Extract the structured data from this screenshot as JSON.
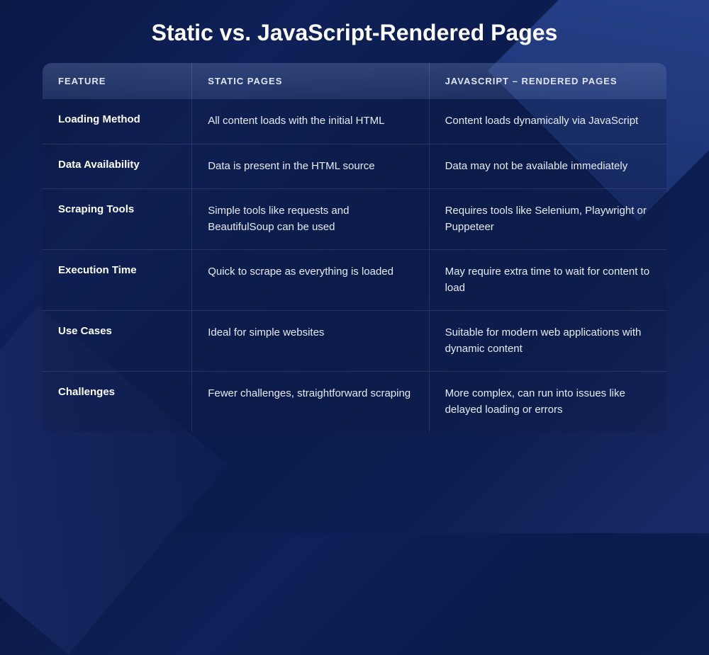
{
  "title": "Static vs. JavaScript-Rendered Pages",
  "headers": {
    "feature": "FEATURE",
    "static": "STATIC PAGES",
    "javascript": "JAVASCRIPT – RENDERED PAGES"
  },
  "rows": [
    {
      "feature": "Loading Method",
      "static": "All content loads with the initial HTML",
      "javascript": "Content loads dynamically via JavaScript"
    },
    {
      "feature": "Data Availability",
      "static": "Data is present in the HTML source",
      "javascript": "Data may not be available immediately"
    },
    {
      "feature": "Scraping Tools",
      "static": "Simple tools like requests and BeautifulSoup can be used",
      "javascript": "Requires tools like Selenium, Playwright or Puppeteer"
    },
    {
      "feature": "Execution Time",
      "static": "Quick to scrape as everything is loaded",
      "javascript": "May require extra time to wait for content to load"
    },
    {
      "feature": "Use Cases",
      "static": "Ideal for simple websites",
      "javascript": "Suitable for modern web applications with dynamic content"
    },
    {
      "feature": "Challenges",
      "static": "Fewer challenges, straightforward scraping",
      "javascript": "More complex, can run into issues like delayed loading or errors"
    }
  ]
}
